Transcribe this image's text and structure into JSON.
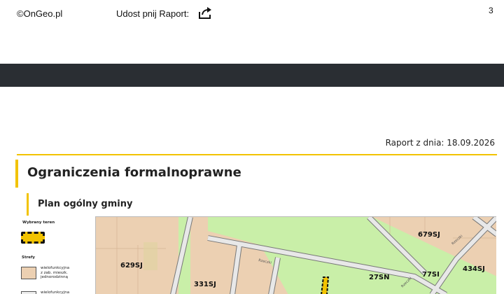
{
  "header": {
    "copyright": "©OnGeo.pl",
    "share_label": "Udost pnij Raport:",
    "share_icon": "share-arrow-icon",
    "page_number": "3"
  },
  "report": {
    "date_label": "Raport z dnia: 18.09.2026"
  },
  "section": {
    "title": "Ograniczenia formalnoprawne",
    "subtitle": "Plan ogólny gminy"
  },
  "legend": {
    "selected_title": "Wybrany teren",
    "zones_title": "Strefy",
    "zone1_line1": "wielofunkcyjna",
    "zone1_line2": "z zab. mieszk.",
    "zone1_line3": "jednorodzinną",
    "zone2_line1": "wielofunkcyjna"
  },
  "map": {
    "zones": {
      "z1": "679SJ",
      "z2": "629SJ",
      "z3": "27SN",
      "z4": "77SI",
      "z5": "434SJ",
      "z6": "331SJ"
    },
    "streets": {
      "s1": "Rzeczki",
      "s2": "Rzeczki",
      "s3": "Rzeczki"
    },
    "colors": {
      "residential": "#ecd0b2",
      "green": "#c9efa8",
      "road": "#e6e6e6",
      "selected": "#f2c300"
    }
  }
}
